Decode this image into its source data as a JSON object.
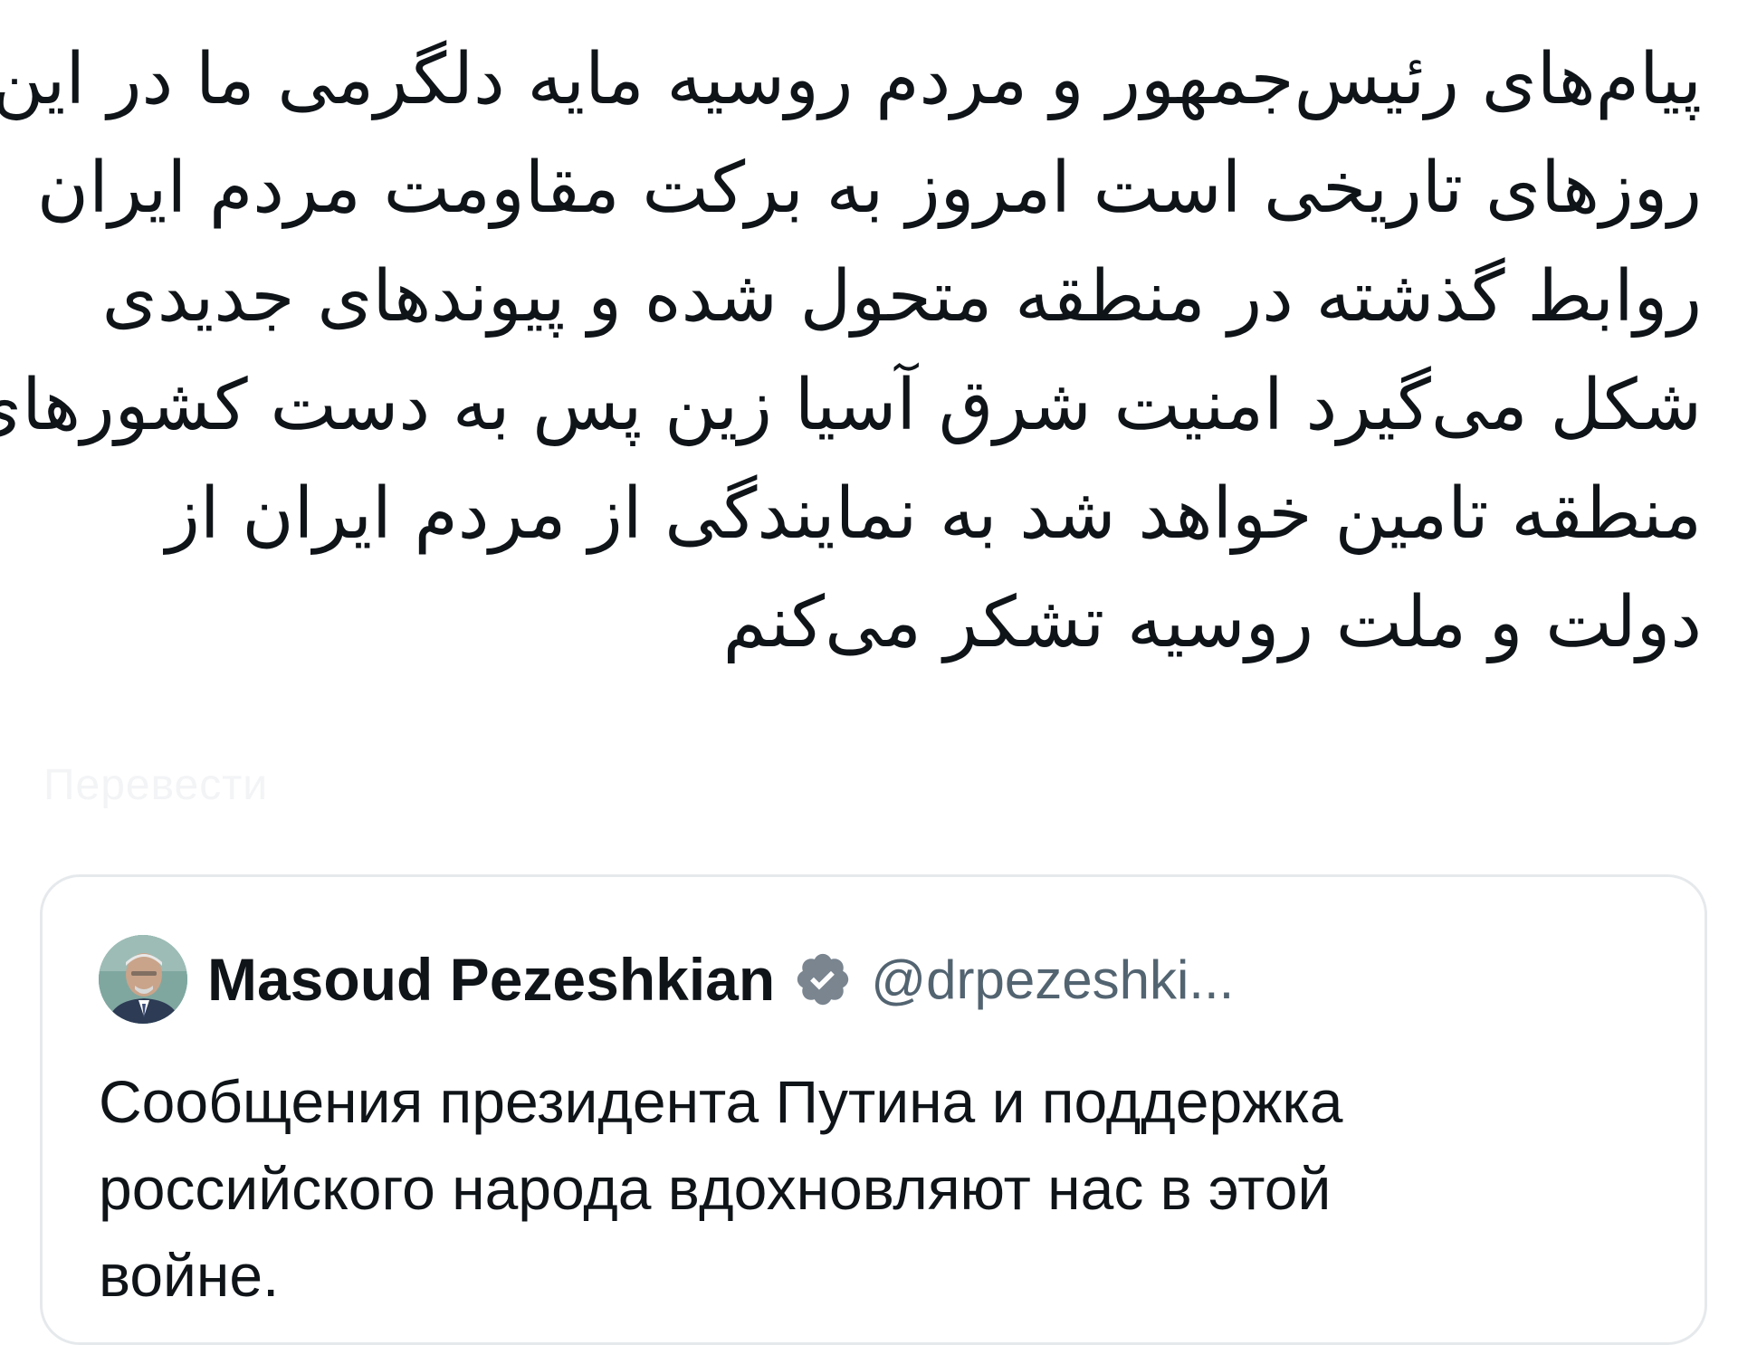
{
  "tweet": {
    "lines": [
      "پیام‌های رئیس‌جمهور و مردم روسیه مایه دلگرمی ما در این",
      "روزهای تاریخی است امروز به برکت مقاومت مردم ایران",
      "روابط گذشته در منطقه متحول شده و پیوندهای جدیدی",
      "شکل می‌گیرد امنیت شرق آسیا زین پس به دست کشورهای",
      "منطقه تامین خواهد شد به نمایندگی از مردم ایران از",
      "دولت و ملت روسیه تشکر می‌کنم"
    ],
    "translate_hint": "Перевести"
  },
  "quoted_tweet": {
    "author_name": "Masoud Pezeshkian",
    "handle": "@drpezeshki...",
    "verified_icon": "verified-badge-icon",
    "avatar_icon": "avatar-photo",
    "text_lines": [
      "Сообщения президента Путина и поддержка",
      "российского народа вдохновляют нас в этой",
      "войне."
    ]
  },
  "colors": {
    "text": "#0f1419",
    "secondary_text": "#536471",
    "card_border": "#e6e9ec",
    "verified_badge": "#7a8590"
  }
}
